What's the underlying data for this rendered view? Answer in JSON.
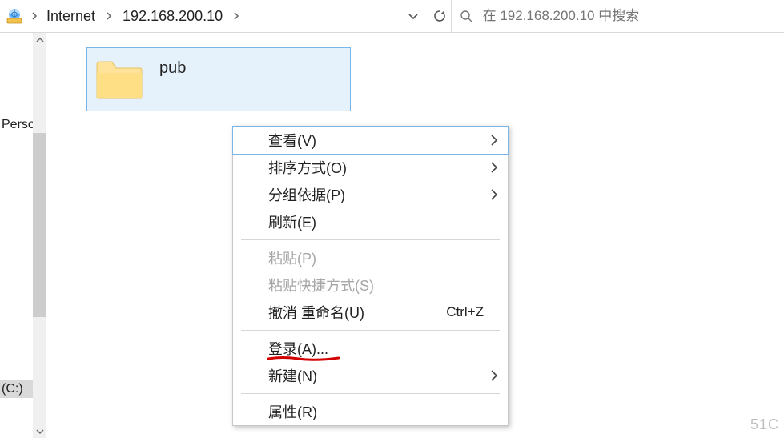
{
  "breadcrumb": {
    "item1": "Internet",
    "item2": "192.168.200.10"
  },
  "search": {
    "placeholder": "在 192.168.200.10 中搜索"
  },
  "nav": {
    "personal": "Person",
    "drive": "(C:)"
  },
  "folder": {
    "name": "pub"
  },
  "contextMenu": {
    "view": "查看(V)",
    "sort": "排序方式(O)",
    "group": "分组依据(P)",
    "refresh": "刷新(E)",
    "paste": "粘贴(P)",
    "pasteShort": "粘贴快捷方式(S)",
    "undo": "撤消 重命名(U)",
    "undoShortcut": "Ctrl+Z",
    "login": "登录(A)...",
    "new": "新建(N)",
    "properties": "属性(R)"
  },
  "watermark": "51C"
}
